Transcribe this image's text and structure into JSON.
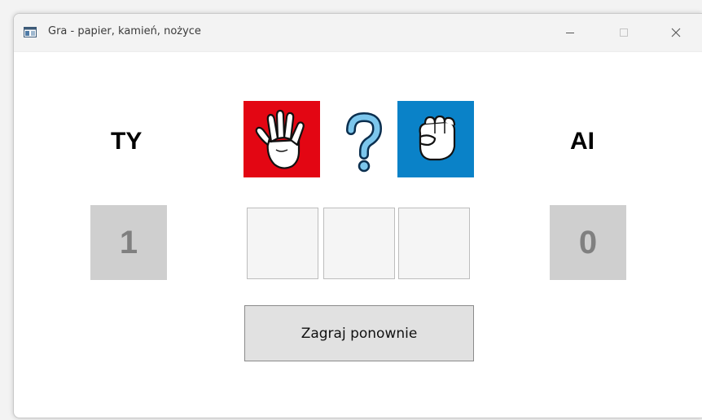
{
  "window": {
    "title": "Gra - papier, kamień, nożyce",
    "icon": "app-window-icon"
  },
  "controls": {
    "minimize_icon": "minimize-icon",
    "maximize_icon": "maximize-icon",
    "close_icon": "close-icon"
  },
  "game": {
    "player_label": "TY",
    "ai_label": "AI",
    "player_score": "1",
    "ai_score": "0",
    "player_choice": "paper",
    "ai_choice": "rock",
    "result_icon": "question-mark-icon",
    "choice_buttons": [
      "",
      "",
      ""
    ],
    "replay_label": "Zagraj ponownie"
  },
  "colors": {
    "player_choice_bg": "#e30613",
    "ai_choice_bg": "#0a82c8",
    "score_bg": "#cfcfcf"
  }
}
